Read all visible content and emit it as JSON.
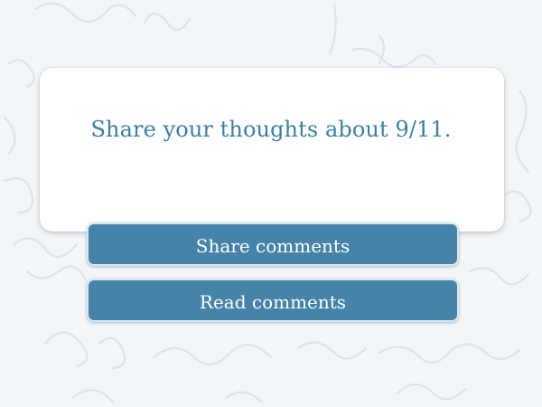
{
  "card": {
    "prompt": "Share your thoughts about 9/11."
  },
  "actions": {
    "share_label": "Share comments",
    "read_label": "Read comments"
  },
  "colors": {
    "background": "#f3f6f9",
    "accent_text": "#3d7fa3",
    "button_fill": "#4584a8",
    "button_text": "#ffffff"
  }
}
